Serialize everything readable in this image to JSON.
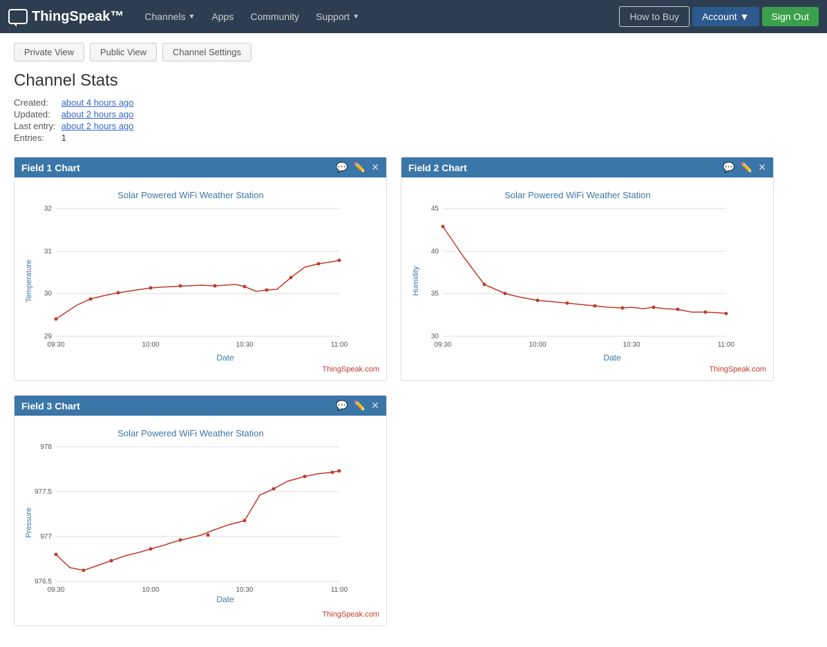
{
  "nav": {
    "brand": "ThingSpeak™",
    "channels_label": "Channels",
    "apps_label": "Apps",
    "community_label": "Community",
    "support_label": "Support",
    "how_to_buy_label": "How to Buy",
    "account_label": "Account",
    "sign_out_label": "Sign Out"
  },
  "top_bar": {
    "btn1": "Private View",
    "btn2": "Public View",
    "btn3": "Channel Settings"
  },
  "channel_stats": {
    "title": "Channel Stats",
    "created_label": "Created:",
    "created_value": "about 4 hours ago",
    "updated_label": "Updated:",
    "updated_value": "about 2 hours ago",
    "last_entry_label": "Last entry:",
    "last_entry_value": "about 2 hours ago",
    "entries_label": "Entries:",
    "entries_value": "1"
  },
  "chart1": {
    "title": "Field 1 Chart",
    "chart_title": "Solar Powered WiFi Weather Station",
    "y_label": "Temperature",
    "x_label": "Date",
    "watermark": "ThingSpeak.com",
    "y_min": 29,
    "y_max": 32,
    "y_ticks": [
      32,
      31,
      30,
      29
    ],
    "x_ticks": [
      "09:30",
      "10:00",
      "10:30",
      "11:00"
    ]
  },
  "chart2": {
    "title": "Field 2 Chart",
    "chart_title": "Solar Powered WiFi Weather Station",
    "y_label": "Humidity",
    "x_label": "Date",
    "watermark": "ThingSpeak.com",
    "y_min": 30,
    "y_max": 45,
    "y_ticks": [
      45,
      40,
      35,
      30
    ],
    "x_ticks": [
      "09:30",
      "10:00",
      "10:30",
      "11:00"
    ]
  },
  "chart3": {
    "title": "Field 3 Chart",
    "chart_title": "Solar Powered WiFi Weather Station",
    "y_label": "Pressure",
    "x_label": "Date",
    "watermark": "ThingSpeak.com",
    "y_min": 976.5,
    "y_max": 978,
    "y_ticks": [
      978,
      977.5,
      977,
      976.5
    ],
    "x_ticks": [
      "09:30",
      "10:00",
      "10:30",
      "11:00"
    ]
  }
}
